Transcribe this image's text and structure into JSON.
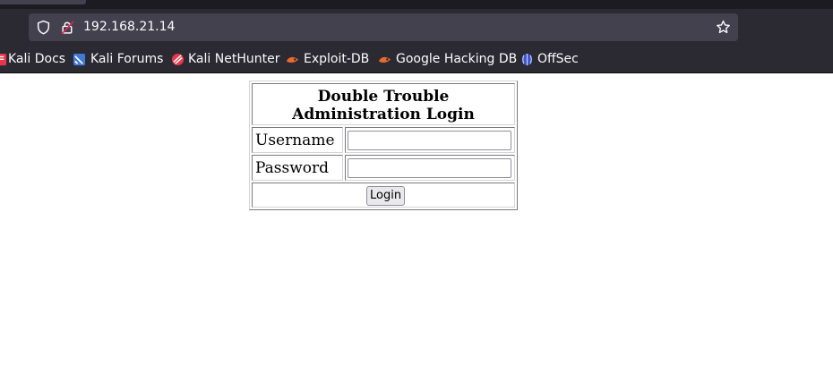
{
  "browser": {
    "url": "192.168.21.14",
    "bookmarks": [
      {
        "label": "Kali Docs",
        "icon": "kali-docs-icon"
      },
      {
        "label": "Kali Forums",
        "icon": "kali-forums-icon"
      },
      {
        "label": "Kali NetHunter",
        "icon": "kali-nethunter-icon"
      },
      {
        "label": "Exploit-DB",
        "icon": "exploit-db-icon"
      },
      {
        "label": "Google Hacking DB",
        "icon": "ghdb-icon"
      },
      {
        "label": "OffSec",
        "icon": "offsec-icon"
      }
    ]
  },
  "login": {
    "title": "Double Trouble Administration Login",
    "username_label": "Username",
    "password_label": "Password",
    "username_value": "",
    "password_value": "",
    "button_label": "Login"
  }
}
